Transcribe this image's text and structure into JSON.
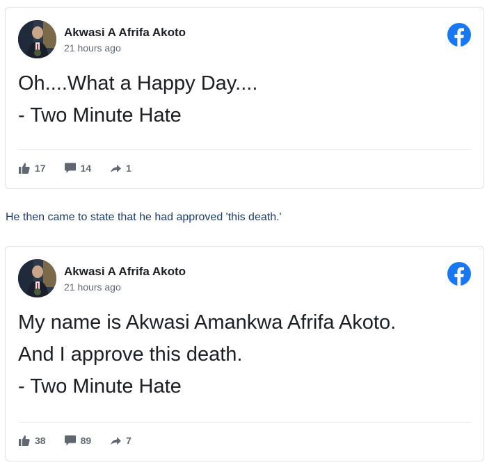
{
  "posts": [
    {
      "author": "Akwasi A Afrifa Akoto",
      "time": "21 hours ago",
      "lines": [
        "Oh....What a Happy Day....",
        "- Two Minute Hate"
      ],
      "likes": "17",
      "comments": "14",
      "shares": "1"
    },
    {
      "author": "Akwasi A Afrifa Akoto",
      "time": "21 hours ago",
      "lines": [
        "My name is Akwasi Amankwa Afrifa Akoto.",
        "And I approve this death.",
        "- Two Minute Hate"
      ],
      "likes": "38",
      "comments": "89",
      "shares": "7"
    }
  ],
  "caption": "He then came to state that he had approved 'this death.'",
  "icons": {
    "brand": "facebook-icon",
    "like": "thumbs-up-icon",
    "comment": "comment-bubble-icon",
    "share": "share-arrow-icon"
  },
  "colors": {
    "facebook_blue": "#1877f2",
    "author_text": "#1c1e21",
    "meta_text": "#606770",
    "caption_text": "#1d3c6e"
  }
}
